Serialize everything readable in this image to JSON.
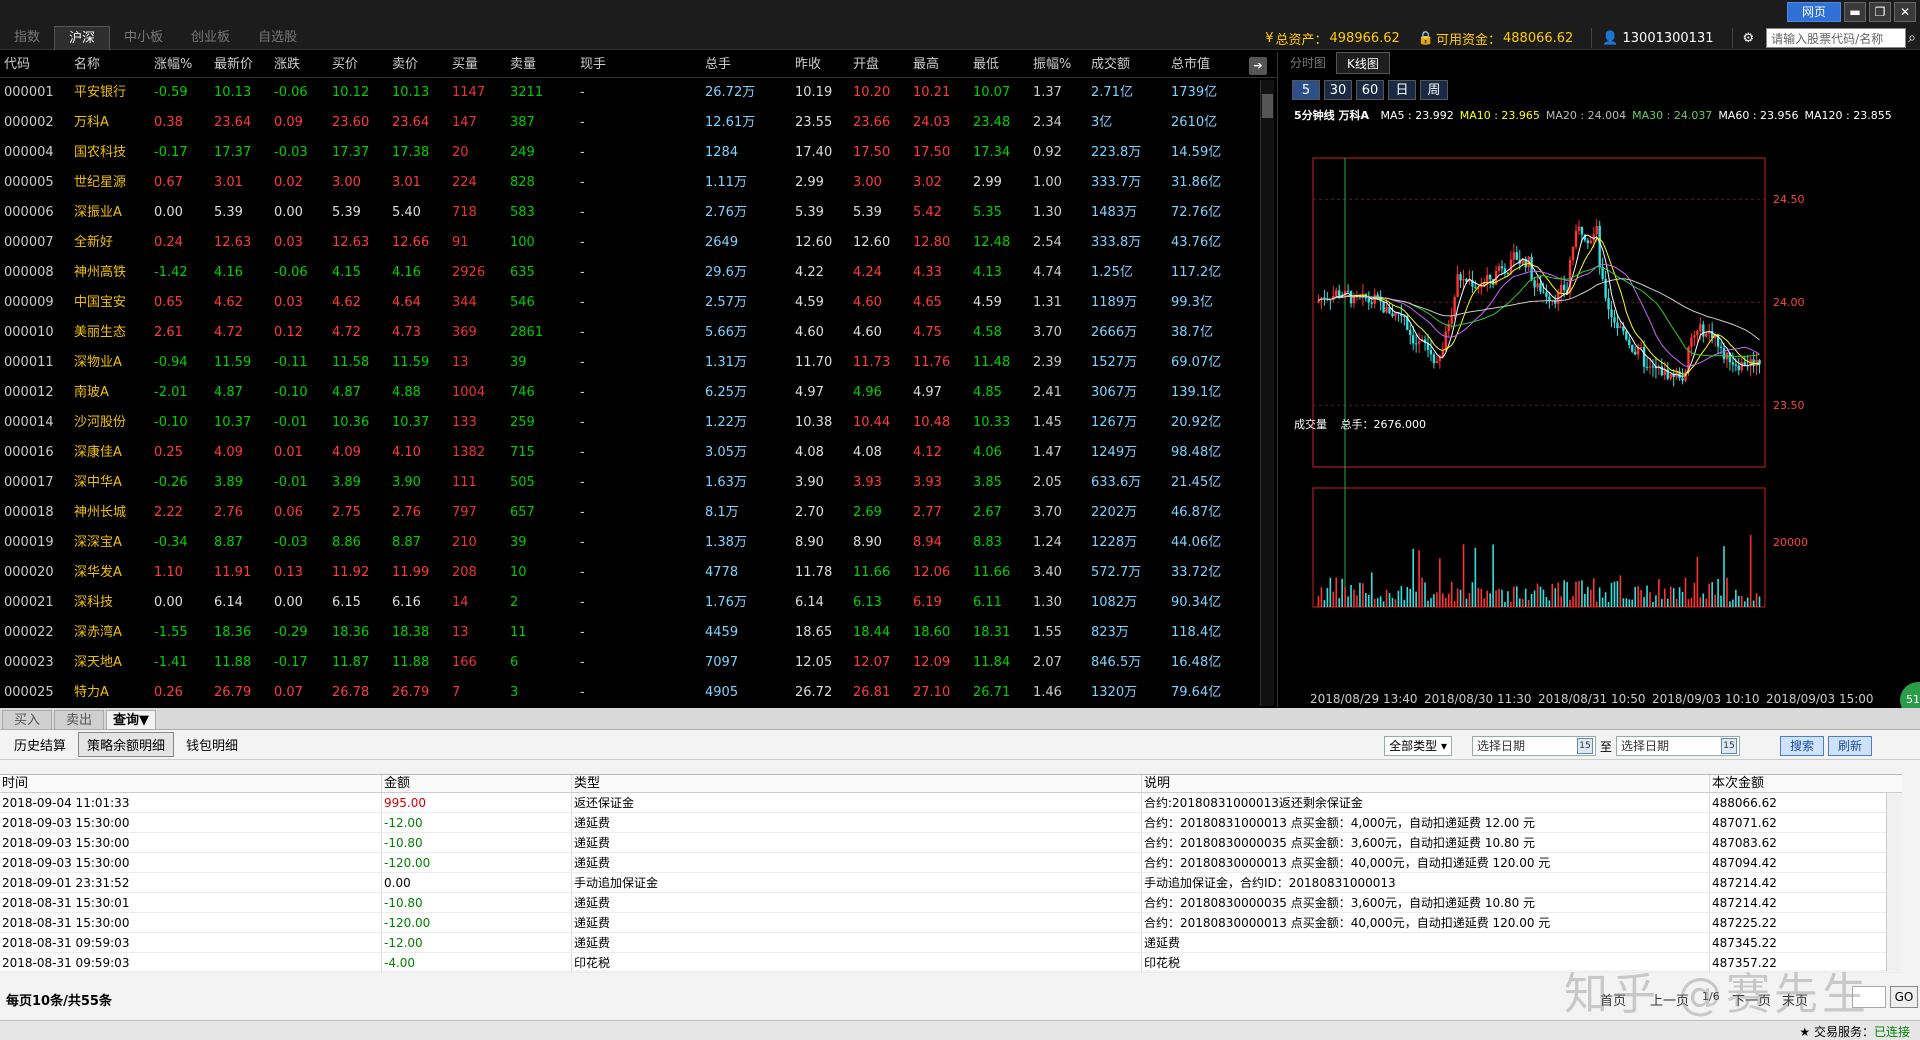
{
  "market_tabs": [
    "指数",
    "沪深",
    "中小板",
    "创业板",
    "自选股"
  ],
  "account": {
    "total_assets_label": "总资产：",
    "total_assets": "498966.62",
    "available_label": "可用资金：",
    "available": "488066.62",
    "user": "13001300131",
    "search_placeholder": "请输入股票代码/名称"
  },
  "window": {
    "web_label": "网页"
  },
  "quote_headers": [
    "代码",
    "名称",
    "涨幅%",
    "最新价",
    "涨跌",
    "买价",
    "卖价",
    "买量",
    "卖量",
    "现手",
    "总手",
    "昨收",
    "开盘",
    "最高",
    "最低",
    "振幅%",
    "成交额",
    "总市值"
  ],
  "quotes": [
    [
      "000001",
      "平安银行",
      "-0.59",
      "10.13",
      "-0.06",
      "10.12",
      "10.13",
      "1147",
      "3211",
      "-",
      "26.72万",
      "10.19",
      "10.20",
      "10.21",
      "10.07",
      "1.37",
      "2.71亿",
      "1739亿"
    ],
    [
      "000002",
      "万科A",
      "0.38",
      "23.64",
      "0.09",
      "23.60",
      "23.64",
      "147",
      "387",
      "-",
      "12.61万",
      "23.55",
      "23.66",
      "24.03",
      "23.48",
      "2.34",
      "3亿",
      "2610亿"
    ],
    [
      "000004",
      "国农科技",
      "-0.17",
      "17.37",
      "-0.03",
      "17.37",
      "17.38",
      "20",
      "249",
      "-",
      "1284",
      "17.40",
      "17.50",
      "17.50",
      "17.34",
      "0.92",
      "223.8万",
      "14.59亿"
    ],
    [
      "000005",
      "世纪星源",
      "0.67",
      "3.01",
      "0.02",
      "3.00",
      "3.01",
      "224",
      "828",
      "-",
      "1.11万",
      "2.99",
      "3.00",
      "3.02",
      "2.99",
      "1.00",
      "333.7万",
      "31.86亿"
    ],
    [
      "000006",
      "深振业A",
      "0.00",
      "5.39",
      "0.00",
      "5.39",
      "5.40",
      "718",
      "583",
      "-",
      "2.76万",
      "5.39",
      "5.39",
      "5.42",
      "5.35",
      "1.30",
      "1483万",
      "72.76亿"
    ],
    [
      "000007",
      "全新好",
      "0.24",
      "12.63",
      "0.03",
      "12.63",
      "12.66",
      "91",
      "100",
      "-",
      "2649",
      "12.60",
      "12.60",
      "12.80",
      "12.48",
      "2.54",
      "333.8万",
      "43.76亿"
    ],
    [
      "000008",
      "神州高铁",
      "-1.42",
      "4.16",
      "-0.06",
      "4.15",
      "4.16",
      "2926",
      "635",
      "-",
      "29.6万",
      "4.22",
      "4.24",
      "4.33",
      "4.13",
      "4.74",
      "1.25亿",
      "117.2亿"
    ],
    [
      "000009",
      "中国宝安",
      "0.65",
      "4.62",
      "0.03",
      "4.62",
      "4.64",
      "344",
      "546",
      "-",
      "2.57万",
      "4.59",
      "4.60",
      "4.65",
      "4.59",
      "1.31",
      "1189万",
      "99.3亿"
    ],
    [
      "000010",
      "美丽生态",
      "2.61",
      "4.72",
      "0.12",
      "4.72",
      "4.73",
      "369",
      "2861",
      "-",
      "5.66万",
      "4.60",
      "4.60",
      "4.75",
      "4.58",
      "3.70",
      "2666万",
      "38.7亿"
    ],
    [
      "000011",
      "深物业A",
      "-0.94",
      "11.59",
      "-0.11",
      "11.58",
      "11.59",
      "13",
      "39",
      "-",
      "1.31万",
      "11.70",
      "11.73",
      "11.76",
      "11.48",
      "2.39",
      "1527万",
      "69.07亿"
    ],
    [
      "000012",
      "南玻A",
      "-2.01",
      "4.87",
      "-0.10",
      "4.87",
      "4.88",
      "1004",
      "746",
      "-",
      "6.25万",
      "4.97",
      "4.96",
      "4.97",
      "4.85",
      "2.41",
      "3067万",
      "139.1亿"
    ],
    [
      "000014",
      "沙河股份",
      "-0.10",
      "10.37",
      "-0.01",
      "10.36",
      "10.37",
      "133",
      "259",
      "-",
      "1.22万",
      "10.38",
      "10.44",
      "10.48",
      "10.33",
      "1.45",
      "1267万",
      "20.92亿"
    ],
    [
      "000016",
      "深康佳A",
      "0.25",
      "4.09",
      "0.01",
      "4.09",
      "4.10",
      "1382",
      "715",
      "-",
      "3.05万",
      "4.08",
      "4.08",
      "4.12",
      "4.06",
      "1.47",
      "1249万",
      "98.48亿"
    ],
    [
      "000017",
      "深中华A",
      "-0.26",
      "3.89",
      "-0.01",
      "3.89",
      "3.90",
      "111",
      "505",
      "-",
      "1.63万",
      "3.90",
      "3.93",
      "3.93",
      "3.85",
      "2.05",
      "633.6万",
      "21.45亿"
    ],
    [
      "000018",
      "神州长城",
      "2.22",
      "2.76",
      "0.06",
      "2.75",
      "2.76",
      "797",
      "657",
      "-",
      "8.1万",
      "2.70",
      "2.69",
      "2.77",
      "2.67",
      "3.70",
      "2202万",
      "46.87亿"
    ],
    [
      "000019",
      "深深宝A",
      "-0.34",
      "8.87",
      "-0.03",
      "8.86",
      "8.87",
      "210",
      "39",
      "-",
      "1.38万",
      "8.90",
      "8.90",
      "8.94",
      "8.83",
      "1.24",
      "1228万",
      "44.06亿"
    ],
    [
      "000020",
      "深华发A",
      "1.10",
      "11.91",
      "0.13",
      "11.92",
      "11.99",
      "208",
      "10",
      "-",
      "4778",
      "11.78",
      "11.66",
      "12.06",
      "11.66",
      "3.40",
      "572.7万",
      "33.72亿"
    ],
    [
      "000021",
      "深科技",
      "0.00",
      "6.14",
      "0.00",
      "6.15",
      "6.16",
      "14",
      "2",
      "-",
      "1.76万",
      "6.14",
      "6.13",
      "6.19",
      "6.11",
      "1.30",
      "1082万",
      "90.34亿"
    ],
    [
      "000022",
      "深赤湾A",
      "-1.55",
      "18.36",
      "-0.29",
      "18.36",
      "18.38",
      "13",
      "11",
      "-",
      "4459",
      "18.65",
      "18.44",
      "18.60",
      "18.31",
      "1.55",
      "823万",
      "118.4亿"
    ],
    [
      "000023",
      "深天地A",
      "-1.41",
      "11.88",
      "-0.17",
      "11.87",
      "11.88",
      "166",
      "6",
      "-",
      "7097",
      "12.05",
      "12.07",
      "12.09",
      "11.84",
      "2.07",
      "846.5万",
      "16.48亿"
    ],
    [
      "000025",
      "特力A",
      "0.26",
      "26.79",
      "0.07",
      "26.78",
      "26.79",
      "7",
      "3",
      "-",
      "4905",
      "26.72",
      "26.81",
      "27.10",
      "26.71",
      "1.46",
      "1320万",
      "79.64亿"
    ]
  ],
  "chart": {
    "tabs": [
      "分时图",
      "K线图"
    ],
    "periods": [
      "5",
      "30",
      "60",
      "日",
      "周"
    ],
    "title": "5分钟线 万科A",
    "ma": [
      {
        "label": "MA5 : 23.992",
        "color": "#ffffff"
      },
      {
        "label": "MA10 : 23.965",
        "color": "#ffff00"
      },
      {
        "label": "MA20 : 24.004",
        "color": "#bbbbbb"
      },
      {
        "label": "MA30 : 24.037",
        "color": "#66cc66"
      },
      {
        "label": "MA60 : 23.956",
        "color": "#ffffff"
      },
      {
        "label": "MA120 : 23.855",
        "color": "#ffffff"
      }
    ],
    "price_ticks": [
      "24.50",
      "24.00",
      "23.50"
    ],
    "vol_label": "成交量",
    "vol_total": "总手：2676.000",
    "vol_tick": "20000",
    "dates": [
      "2018/08/29 13:40",
      "2018/08/30 11:30",
      "2018/08/31 10:50",
      "2018/09/03 10:10",
      "2018/09/03 15:00"
    ],
    "colors": {
      "up": "#ff3333",
      "down": "#33e0e0",
      "ma5": "#ffffff",
      "ma10": "#ffff00",
      "ma20": "#cc66ff",
      "ma30": "#33cc33",
      "ma60": "#cccccc",
      "frame": "#cc2222"
    }
  },
  "chart_data": {
    "type": "candlestick",
    "title": "5分钟线 万科A",
    "x_start": "2018/08/29 13:40",
    "x_end": "2018/09/03 15:00",
    "ylim": [
      23.2,
      24.7
    ],
    "yticks": [
      23.5,
      24.0,
      24.5
    ],
    "last_ma": {
      "MA5": 23.992,
      "MA10": 23.965,
      "MA20": 24.004,
      "MA30": 24.037,
      "MA60": 23.956,
      "MA120": 23.855
    },
    "volume_ticks": [
      20000
    ]
  },
  "trade_tabs": [
    "买入",
    "卖出",
    "查询▼"
  ],
  "sub_tabs": [
    "历史结算",
    "策略余额明细",
    "钱包明细"
  ],
  "filters": {
    "type": "全部类型",
    "date_from": "选择日期",
    "to": "至",
    "date_to": "选择日期",
    "search": "搜索",
    "refresh": "刷新"
  },
  "ledger_headers": [
    "时间",
    "金额",
    "类型",
    "说明",
    "本次金额"
  ],
  "ledger": [
    [
      "2018-09-04 11:01:33",
      "995.00",
      "返还保证金",
      "合约:20180831000013返还剩余保证金",
      "488066.62"
    ],
    [
      "2018-09-03 15:30:00",
      "-12.00",
      "递延费",
      "合约：20180831000013 点买金额：4,000元，自动扣递延费 12.00 元",
      "487071.62"
    ],
    [
      "2018-09-03 15:30:00",
      "-10.80",
      "递延费",
      "合约：20180830000035 点买金额：3,600元，自动扣递延费 10.80 元",
      "487083.62"
    ],
    [
      "2018-09-03 15:30:00",
      "-120.00",
      "递延费",
      "合约：20180830000013 点买金额：40,000元，自动扣递延费 120.00 元",
      "487094.42"
    ],
    [
      "2018-09-01 23:31:52",
      "0.00",
      "手动追加保证金",
      "手动追加保证金，合约ID：20180831000013",
      "487214.42"
    ],
    [
      "2018-08-31 15:30:01",
      "-10.80",
      "递延费",
      "合约：20180830000035 点买金额：3,600元，自动扣递延费 10.80 元",
      "487214.42"
    ],
    [
      "2018-08-31 15:30:00",
      "-120.00",
      "递延费",
      "合约：20180830000013 点买金额：40,000元，自动扣递延费 120.00 元",
      "487225.22"
    ],
    [
      "2018-08-31 09:59:03",
      "-12.00",
      "递延费",
      "递延费",
      "487345.22"
    ],
    [
      "2018-08-31 09:59:03",
      "-4.00",
      "印花税",
      "印花税",
      "487357.22"
    ]
  ],
  "pager": {
    "info": "每页10条/共55条",
    "first": "首页",
    "prev": "上一页",
    "page": "1/6",
    "next": "下一页",
    "last": "末页",
    "go": "GO"
  },
  "status": {
    "label": "★ 交易服务：",
    "value": "已连接"
  },
  "watermark": "知乎 @赛先生"
}
